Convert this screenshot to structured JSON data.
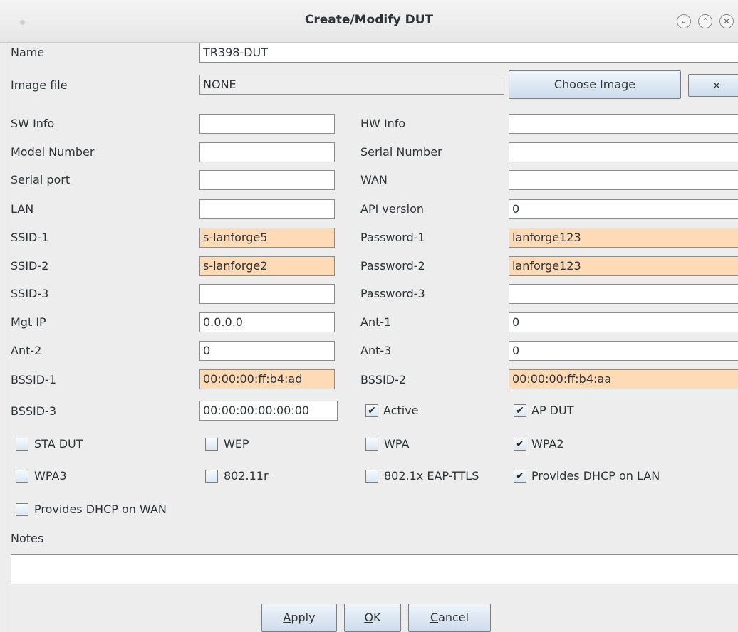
{
  "window": {
    "title": "Create/Modify DUT",
    "controls": [
      "chevron-down-icon",
      "chevron-up-icon",
      "close-icon"
    ]
  },
  "name": {
    "label": "Name",
    "value": "TR398-DUT"
  },
  "image": {
    "label": "Image file",
    "value": "NONE",
    "choose_label": "Choose Image",
    "clear_label": "×"
  },
  "fields": {
    "sw_info": {
      "label": "SW Info",
      "value": ""
    },
    "hw_info": {
      "label": "HW Info",
      "value": ""
    },
    "model_number": {
      "label": "Model Number",
      "value": ""
    },
    "serial_number": {
      "label": "Serial Number",
      "value": ""
    },
    "serial_port": {
      "label": "Serial port",
      "value": ""
    },
    "wan": {
      "label": "WAN",
      "value": ""
    },
    "lan": {
      "label": "LAN",
      "value": ""
    },
    "api_version": {
      "label": "API version",
      "value": "0"
    },
    "ssid1": {
      "label": "SSID-1",
      "value": "s-lanforge5"
    },
    "password1": {
      "label": "Password-1",
      "value": "lanforge123"
    },
    "ssid2": {
      "label": "SSID-2",
      "value": "s-lanforge2"
    },
    "password2": {
      "label": "Password-2",
      "value": "lanforge123"
    },
    "ssid3": {
      "label": "SSID-3",
      "value": ""
    },
    "password3": {
      "label": "Password-3",
      "value": ""
    },
    "mgt_ip": {
      "label": "Mgt IP",
      "value": "0.0.0.0"
    },
    "ant1": {
      "label": "Ant-1",
      "value": "0"
    },
    "ant2": {
      "label": "Ant-2",
      "value": "0"
    },
    "ant3": {
      "label": "Ant-3",
      "value": "0"
    },
    "bssid1": {
      "label": "BSSID-1",
      "value": "00:00:00:ff:b4:ad"
    },
    "bssid2": {
      "label": "BSSID-2",
      "value": "00:00:00:ff:b4:aa"
    },
    "bssid3": {
      "label": "BSSID-3",
      "value": "00:00:00:00:00:00"
    }
  },
  "checkboxes": {
    "active": {
      "label": "Active",
      "checked": true
    },
    "ap_dut": {
      "label": "AP DUT",
      "checked": true
    },
    "sta_dut": {
      "label": "STA DUT",
      "checked": false
    },
    "wep": {
      "label": "WEP",
      "checked": false
    },
    "wpa": {
      "label": "WPA",
      "checked": false
    },
    "wpa2": {
      "label": "WPA2",
      "checked": true
    },
    "wpa3": {
      "label": "WPA3",
      "checked": false
    },
    "r80211": {
      "label": "802.11r",
      "checked": false
    },
    "eap_ttls": {
      "label": "802.1x EAP-TTLS",
      "checked": false
    },
    "dhcp_lan": {
      "label": "Provides DHCP on LAN",
      "checked": true
    },
    "dhcp_wan": {
      "label": "Provides DHCP on WAN",
      "checked": false
    }
  },
  "notes": {
    "label": "Notes",
    "value": ""
  },
  "buttons": {
    "apply": {
      "mnemonic": "A",
      "rest": "pply"
    },
    "ok": {
      "mnemonic": "O",
      "rest": "K"
    },
    "cancel": {
      "mnemonic": "C",
      "rest": "ancel"
    }
  },
  "colors": {
    "highlight_field": "#ffdab6",
    "window_bg": "#ededed"
  }
}
